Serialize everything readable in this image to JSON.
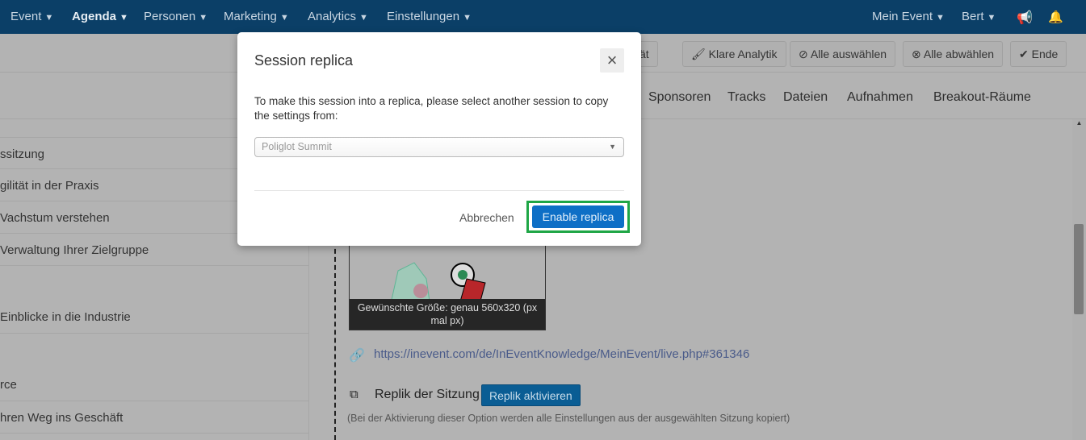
{
  "nav": {
    "left": [
      "Event",
      "Agenda",
      "Personen",
      "Marketing",
      "Analytics",
      "Einstellungen"
    ],
    "active": "Agenda",
    "right": [
      "Mein Event",
      "Bert"
    ],
    "icons": [
      "megaphone-icon",
      "bell-icon"
    ]
  },
  "toolbar": {
    "buttons": [
      "tivität",
      "Klare Analytik",
      "Alle auswählen",
      "Alle abwählen",
      "Ende"
    ]
  },
  "tabs": [
    "Sponsoren",
    "Tracks",
    "Dateien",
    "Aufnahmen",
    "Breakout-Räume"
  ],
  "sidebar": {
    "items": [
      "ssitzung",
      "gilität in der Praxis",
      "Vachstum verstehen",
      "Verwaltung Ihrer Zielgruppe",
      "Einblicke in die Industrie",
      "rce",
      "hren Weg ins Geschäft"
    ]
  },
  "content": {
    "image_caption": "Gewünschte Größe: genau 560x320 (px mal px)",
    "link": "https://inevent.com/de/InEventKnowledge/MeinEvent/live.php#361346",
    "replica_label": "Replik der Sitzung",
    "replica_button": "Replik aktivieren",
    "hint": "(Bei der Aktivierung dieser Option werden alle Einstellungen aus der ausgewählten Sitzung kopiert)"
  },
  "modal": {
    "title": "Session replica",
    "close": "×",
    "text": "To make this session into a replica, please select another session to copy the settings from:",
    "select_value": "Poliglot Summit",
    "cancel": "Abbrechen",
    "confirm": "Enable replica"
  },
  "colors": {
    "nav": "#0b3f67",
    "primary": "#0e6fc6",
    "highlight": "#1fa646"
  }
}
